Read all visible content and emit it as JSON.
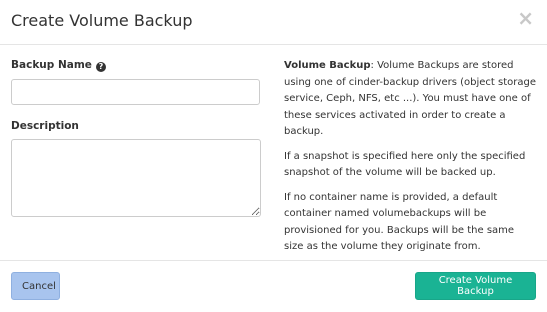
{
  "dialog": {
    "title": "Create Volume Backup",
    "close_glyph": "×"
  },
  "form": {
    "backup_name_label": "Backup Name",
    "backup_name_value": "",
    "description_label": "Description",
    "description_value": ""
  },
  "help": {
    "p1_bold": "Volume Backup",
    "p1_text": ": Volume Backups are stored using one of cinder-backup drivers (object storage service, Ceph, NFS, etc ...). You must have one of these services activated in order to create a backup.",
    "p2": "If a snapshot is specified here only the specified snapshot of the volume will be backed up.",
    "p3": "If no container name is provided, a default container named volumebackups will be provisioned for you. Backups will be the same size as the volume they originate from."
  },
  "footer": {
    "cancel_label": "Cancel",
    "submit_label": "Create Volume Backup"
  },
  "icons": {
    "help": "question-circle-icon",
    "close": "close-icon"
  },
  "colors": {
    "primary": "#1ab394",
    "cancel": "#a8c4ee"
  }
}
